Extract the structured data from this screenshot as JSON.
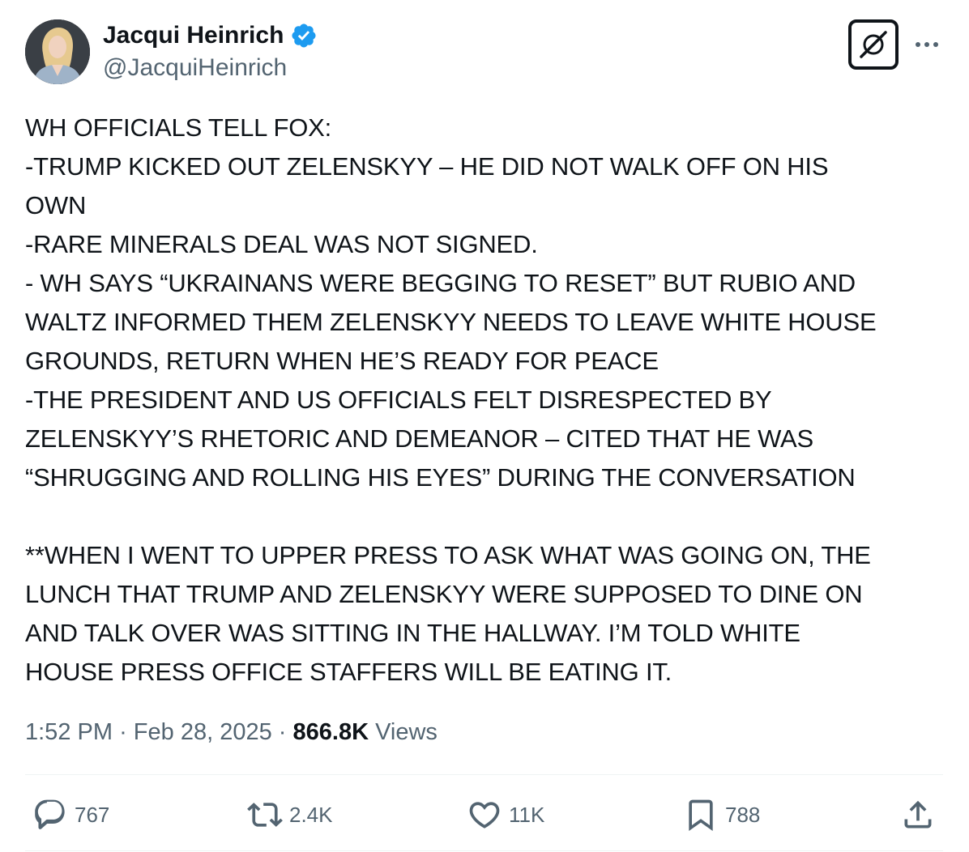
{
  "author": {
    "display_name": "Jacqui Heinrich",
    "handle": "@JacquiHeinrich",
    "verified": true,
    "verified_color": "#1d9bf0",
    "avatar_icon": "profile-photo"
  },
  "header_icons": {
    "grok": "grok-icon",
    "more": "more-icon"
  },
  "tweet": {
    "lines": [
      "WH OFFICIALS TELL FOX:",
      "-TRUMP KICKED OUT ZELENSKYY – HE DID NOT WALK OFF ON HIS",
      "OWN",
      "-RARE MINERALS DEAL WAS NOT SIGNED.",
      "- WH SAYS “UKRAINANS WERE BEGGING TO RESET” BUT RUBIO AND",
      "WALTZ INFORMED THEM ZELENSKYY NEEDS TO LEAVE WHITE HOUSE",
      "GROUNDS, RETURN WHEN HE’S READY FOR PEACE",
      "-THE PRESIDENT AND US OFFICIALS FELT DISRESPECTED BY",
      "ZELENSKYY’S RHETORIC AND DEMEANOR – CITED THAT HE WAS",
      "“SHRUGGING AND ROLLING HIS EYES” DURING THE CONVERSATION",
      "",
      "**WHEN I WENT TO UPPER PRESS TO ASK WHAT WAS GOING ON, THE",
      "LUNCH THAT TRUMP AND ZELENSKYY WERE SUPPOSED TO DINE ON",
      "AND TALK OVER WAS SITTING IN THE HALLWAY. I’M TOLD WHITE",
      "HOUSE PRESS OFFICE STAFFERS WILL BE EATING IT."
    ]
  },
  "meta": {
    "time": "1:52 PM",
    "separator": "·",
    "date": "Feb 28, 2025",
    "views_count": "866.8K",
    "views_label": "Views"
  },
  "actions": {
    "reply": {
      "icon": "reply-icon",
      "count": "767"
    },
    "repost": {
      "icon": "repost-icon",
      "count": "2.4K"
    },
    "like": {
      "icon": "like-icon",
      "count": "11K"
    },
    "bookmark": {
      "icon": "bookmark-icon",
      "count": "788"
    },
    "share": {
      "icon": "share-icon"
    }
  },
  "colors": {
    "text": "#0f1419",
    "secondary": "#536471",
    "divider": "#eff3f4",
    "accent": "#1d9bf0"
  }
}
